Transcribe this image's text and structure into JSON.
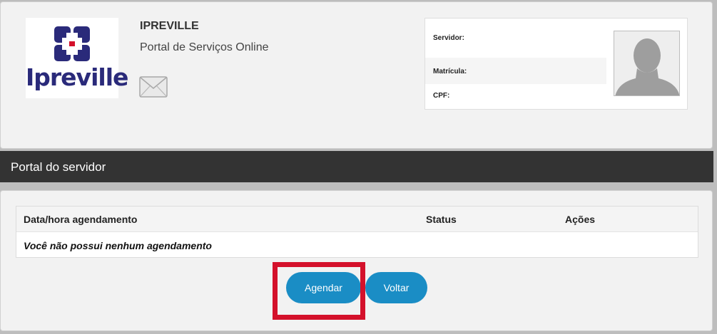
{
  "header": {
    "logo_text": "Ipreville",
    "org_name": "IPREVILLE",
    "org_subtitle": "Portal de Serviços Online",
    "mail_icon": "envelope-icon"
  },
  "user_info": {
    "servidor_label": "Servidor:",
    "matricula_label": "Matrícula:",
    "cpf_label": "CPF:",
    "avatar_icon": "person-silhouette-icon"
  },
  "banner": {
    "title": "Portal do servidor"
  },
  "table": {
    "columns": [
      "Data/hora agendamento",
      "Status",
      "Ações"
    ],
    "empty_message": "Você não possui nenhum agendamento"
  },
  "actions": {
    "agendar_label": "Agendar",
    "voltar_label": "Voltar"
  },
  "colors": {
    "button": "#1a8dc5",
    "banner": "#333333",
    "highlight": "#d4112b",
    "logo_blue": "#2a2a7a",
    "logo_red": "#d4112b"
  }
}
